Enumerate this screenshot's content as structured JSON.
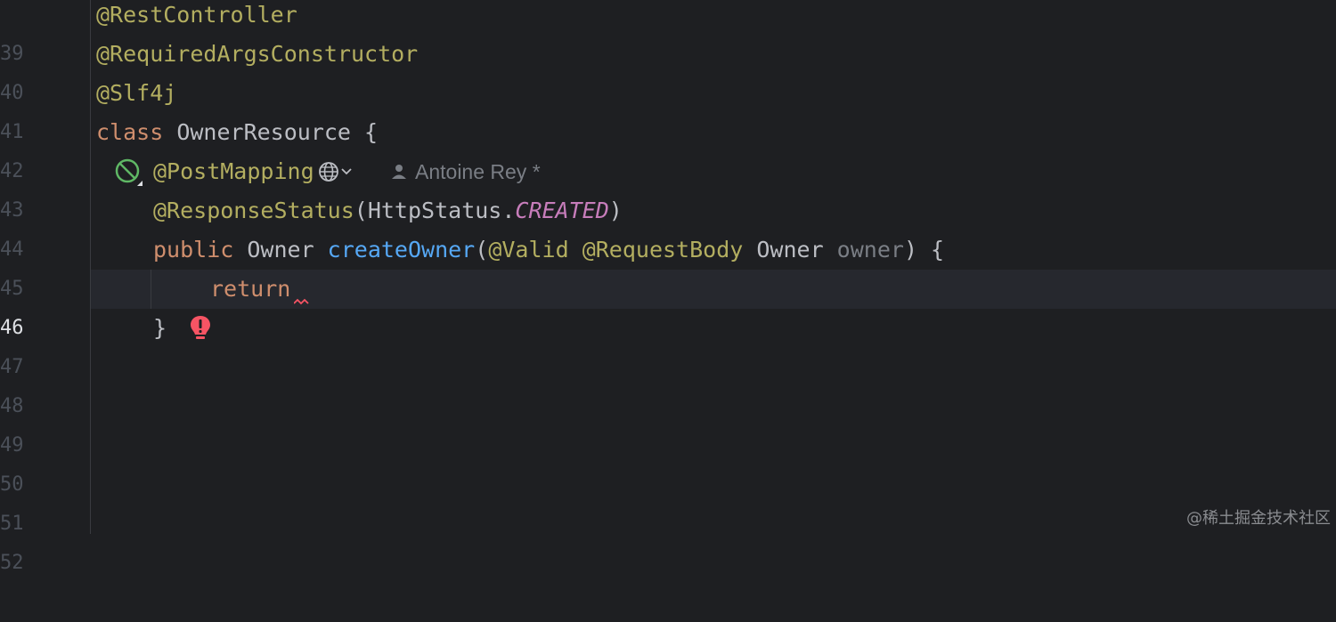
{
  "editor": {
    "lines": [
      {
        "num": "39"
      },
      {
        "num": "40"
      },
      {
        "num": "41"
      },
      {
        "num": "42"
      },
      {
        "num": "43"
      },
      {
        "num": "44"
      },
      {
        "num": "45"
      },
      {
        "num": "46"
      },
      {
        "num": "47"
      },
      {
        "num": "48"
      },
      {
        "num": "49"
      },
      {
        "num": "50"
      },
      {
        "num": "51"
      },
      {
        "num": "52"
      }
    ],
    "code": {
      "l39": "@RestController",
      "l40": "@RequiredArgsConstructor",
      "l41": "@Slf4j",
      "l42_kw": "class",
      "l42_rest": " OwnerResource {",
      "l43": "@PostMapping",
      "l43_author": "Antoine Rey *",
      "l44_ann": "@ResponseStatus",
      "l44_open": "(HttpStatus.",
      "l44_const": "CREATED",
      "l44_close": ")",
      "l45_kw": "public",
      "l45_type": " Owner ",
      "l45_fn": "createOwner",
      "l45_paren": "(",
      "l45_ann1": "@Valid",
      "l45_ann2": "@RequestBody",
      "l45_type2": " Owner ",
      "l45_param": "owner",
      "l45_end": ") {",
      "l46": "return",
      "l47": "}"
    },
    "current_line": "46"
  },
  "icons": {
    "line42": "spring-bean-icon",
    "line45": "spring-endpoint-icon",
    "line43_inline": "globe-chevron-icon",
    "line46": "error-bulb-icon"
  },
  "colors": {
    "background": "#1e1f22",
    "annotation": "#b3ae60",
    "keyword": "#cf8e6d",
    "function": "#56a8f5",
    "constant": "#c77dbb",
    "error": "#f75464"
  },
  "watermark": "@稀土掘金技术社区"
}
